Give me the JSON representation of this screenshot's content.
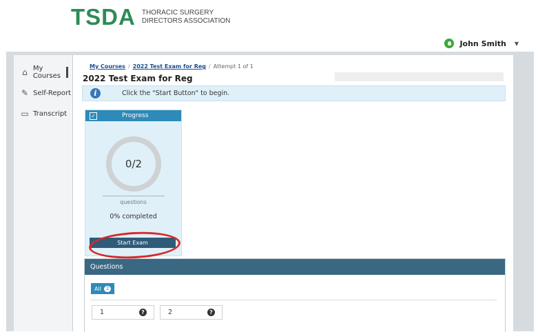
{
  "brand": {
    "mark": "TSDA",
    "line1": "THORACIC SURGERY",
    "line2": "DIRECTORS ASSOCIATION"
  },
  "user": {
    "name": "John Smith"
  },
  "sidebar": {
    "items": [
      {
        "label": "My Courses",
        "icon": "home-icon",
        "active": true
      },
      {
        "label": "Self-Report",
        "icon": "self-report-icon",
        "active": false
      },
      {
        "label": "Transcript",
        "icon": "transcript-icon",
        "active": false
      }
    ]
  },
  "breadcrumb": {
    "items": [
      "My Courses",
      "2022 Test Exam for Reg",
      "Attempt 1 of 1"
    ]
  },
  "page": {
    "title": "2022 Test Exam for Reg"
  },
  "info": {
    "text": "Click the \"Start Button\" to begin."
  },
  "progress": {
    "header": "Progress",
    "answered": 0,
    "total": 2,
    "ring_text": "0/2",
    "unit": "questions",
    "percent_text": "0% completed",
    "start_button": "Start Exam"
  },
  "questions": {
    "header": "Questions",
    "filter_all": "All",
    "count": "2",
    "items": [
      {
        "number": "1"
      },
      {
        "number": "2"
      }
    ]
  },
  "colors": {
    "brand": "#2e8b57",
    "accent": "#2e8ab8",
    "panel_header": "#3a6882",
    "annotation": "#d42a2a"
  }
}
